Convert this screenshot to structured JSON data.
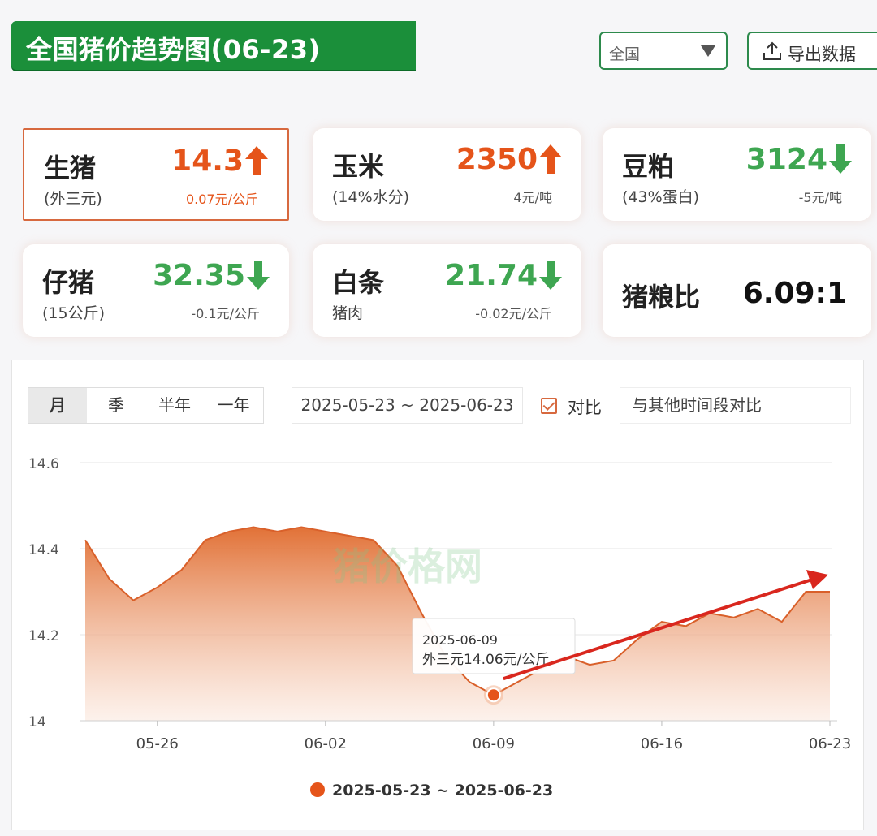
{
  "header": {
    "title": "全国猪价趋势图(06-23)",
    "region": "全国",
    "export_label": "导出数据"
  },
  "colors": {
    "up": "#e5541a",
    "down": "#3ea651",
    "brand": "#1b8f3a",
    "series": "#e06a2c"
  },
  "cards": [
    {
      "name": "生猪",
      "sub": "(外三元)",
      "price": "14.3",
      "change": "0.07元/公斤",
      "trend": "up",
      "arrow_icon": "arrow-up-icon",
      "active": true
    },
    {
      "name": "玉米",
      "sub": "(14%水分)",
      "price": "2350",
      "change": "4元/吨",
      "trend": "up",
      "arrow_icon": "arrow-up-icon",
      "active": false
    },
    {
      "name": "豆粕",
      "sub": "(43%蛋白)",
      "price": "3124",
      "change": "-5元/吨",
      "trend": "down",
      "arrow_icon": "arrow-down-icon",
      "active": false
    },
    {
      "name": "仔猪",
      "sub": "(15公斤)",
      "price": "32.35",
      "change": "-0.1元/公斤",
      "trend": "down",
      "arrow_icon": "arrow-down-icon",
      "active": false
    },
    {
      "name": "白条",
      "sub": "猪肉",
      "price": "21.74",
      "change": "-0.02元/公斤",
      "trend": "down",
      "arrow_icon": "arrow-down-icon",
      "active": false
    },
    {
      "name": "猪粮比",
      "sub": "",
      "price": "6.09:1",
      "change": "",
      "trend": "none",
      "arrow_icon": "",
      "active": false
    }
  ],
  "controls": {
    "periods": [
      "月",
      "季",
      "半年",
      "一年"
    ],
    "active_period": "月",
    "date_range": "2025-05-23 ~ 2025-06-23",
    "compare_label": "对比",
    "compare_checked": true,
    "compare_placeholder": "与其他时间段对比"
  },
  "chart_data": {
    "type": "area",
    "title": "",
    "xlabel": "",
    "ylabel": "",
    "ylim": [
      14,
      14.6
    ],
    "y_ticks": [
      "14",
      "14.2",
      "14.4",
      "14.6"
    ],
    "x_ticks": [
      "05-26",
      "06-02",
      "06-09",
      "06-16",
      "06-23"
    ],
    "grid": true,
    "legend": {
      "position": "bottom-center",
      "entries": [
        "2025-05-23 ~ 2025-06-23"
      ]
    },
    "series": [
      {
        "name": "2025-05-23 ~ 2025-06-23",
        "x": [
          "05-23",
          "05-24",
          "05-25",
          "05-26",
          "05-27",
          "05-28",
          "05-29",
          "05-30",
          "05-31",
          "06-01",
          "06-02",
          "06-03",
          "06-04",
          "06-05",
          "06-06",
          "06-07",
          "06-08",
          "06-09",
          "06-10",
          "06-11",
          "06-12",
          "06-13",
          "06-14",
          "06-15",
          "06-16",
          "06-17",
          "06-18",
          "06-19",
          "06-20",
          "06-21",
          "06-22",
          "06-23"
        ],
        "values": [
          14.42,
          14.33,
          14.28,
          14.31,
          14.35,
          14.42,
          14.44,
          14.45,
          14.44,
          14.45,
          14.44,
          14.43,
          14.42,
          14.36,
          14.25,
          14.15,
          14.09,
          14.06,
          14.09,
          14.12,
          14.15,
          14.13,
          14.14,
          14.19,
          14.23,
          14.22,
          14.25,
          14.24,
          14.26,
          14.23,
          14.3,
          14.3
        ]
      }
    ],
    "tooltip": {
      "date": "2025-06-09",
      "text": "外三元14.06元/公斤"
    },
    "watermark": "猪价格网"
  }
}
